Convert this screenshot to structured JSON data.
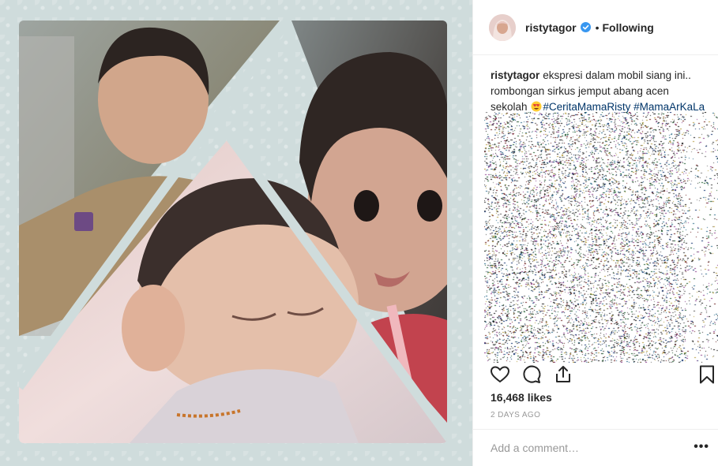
{
  "post": {
    "username": "ristytagor",
    "follow_status": "Following",
    "separator": "•",
    "caption": {
      "line_text_1": "ekspresi dalam mobil siang ini..",
      "line_text_2": "rombongan sirkus jemput abang acen",
      "line_text_3": "sekolah",
      "hashtag_1": "#CeritaMamaRisty",
      "hashtag_2": "#MamaArKaLa"
    },
    "likes": "16,468 likes",
    "timestamp": "2 DAYS AGO",
    "comment": {
      "placeholder": "Add a comment…",
      "more": "•••"
    }
  },
  "icons": {
    "verified": "verified-badge-icon",
    "like": "heart-icon",
    "comment": "comment-bubble-icon",
    "share": "share-icon",
    "save": "bookmark-icon",
    "emoji": "heart-eyes-emoji"
  },
  "colors": {
    "text": "#262626",
    "hashtag": "#003569",
    "muted": "#999999",
    "verified": "#3897f0",
    "media_background": "#cfdcdc"
  }
}
